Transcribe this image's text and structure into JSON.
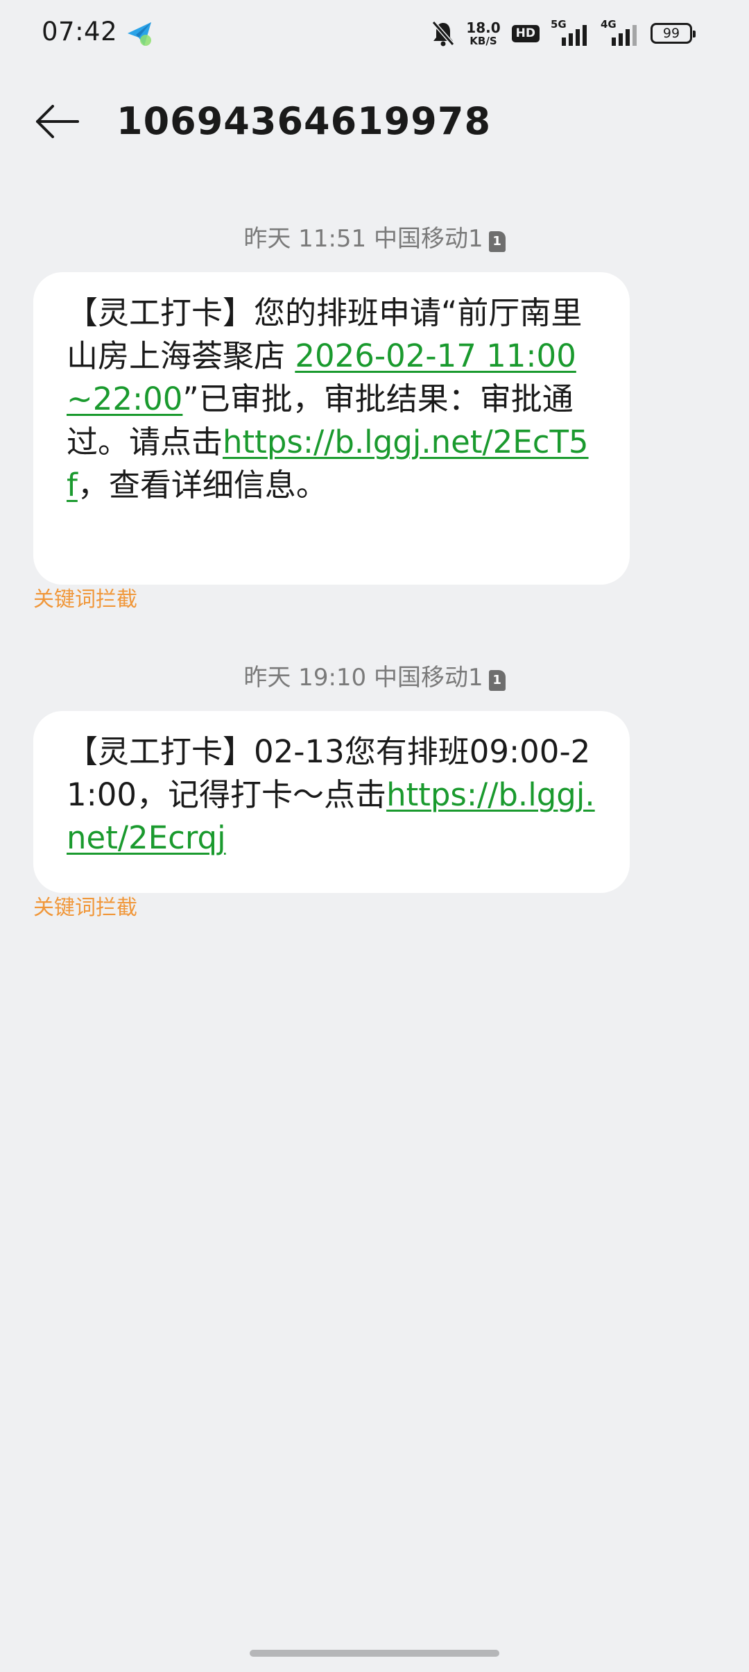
{
  "status_bar": {
    "time": "07:42",
    "net_speed": "18.0",
    "net_speed_unit": "KB/S",
    "hd_label": "HD",
    "sim1_network": "5G",
    "sim2_network": "4G",
    "battery": "99"
  },
  "header": {
    "title": "10694364619978"
  },
  "messages": [
    {
      "meta_time": "昨天 11:51 中国移动1",
      "sim": "1",
      "text_1": "【灵工打卡】您的排班申请“前厅南里山房上海荟聚店 ",
      "link_1": "2026-02-17 11:00~22:00",
      "text_2": "”已审批，审批结果：审批通过。请点击",
      "link_2": "https://b.lggj.net/2EcT5f",
      "text_3": "，查看详细信息。",
      "tag": "关键词拦截"
    },
    {
      "meta_time": "昨天 19:10 中国移动1",
      "sim": "1",
      "text_1": "【灵工打卡】02-13您有排班09:00-21:00，记得打卡～点击",
      "link_1": "https://b.lggj.net/2Ecrqj",
      "tag": "关键词拦截"
    }
  ],
  "colors": {
    "background": "#eff0f2",
    "bubble": "#ffffff",
    "link": "#1a9a2e",
    "tag": "#f0973a"
  }
}
